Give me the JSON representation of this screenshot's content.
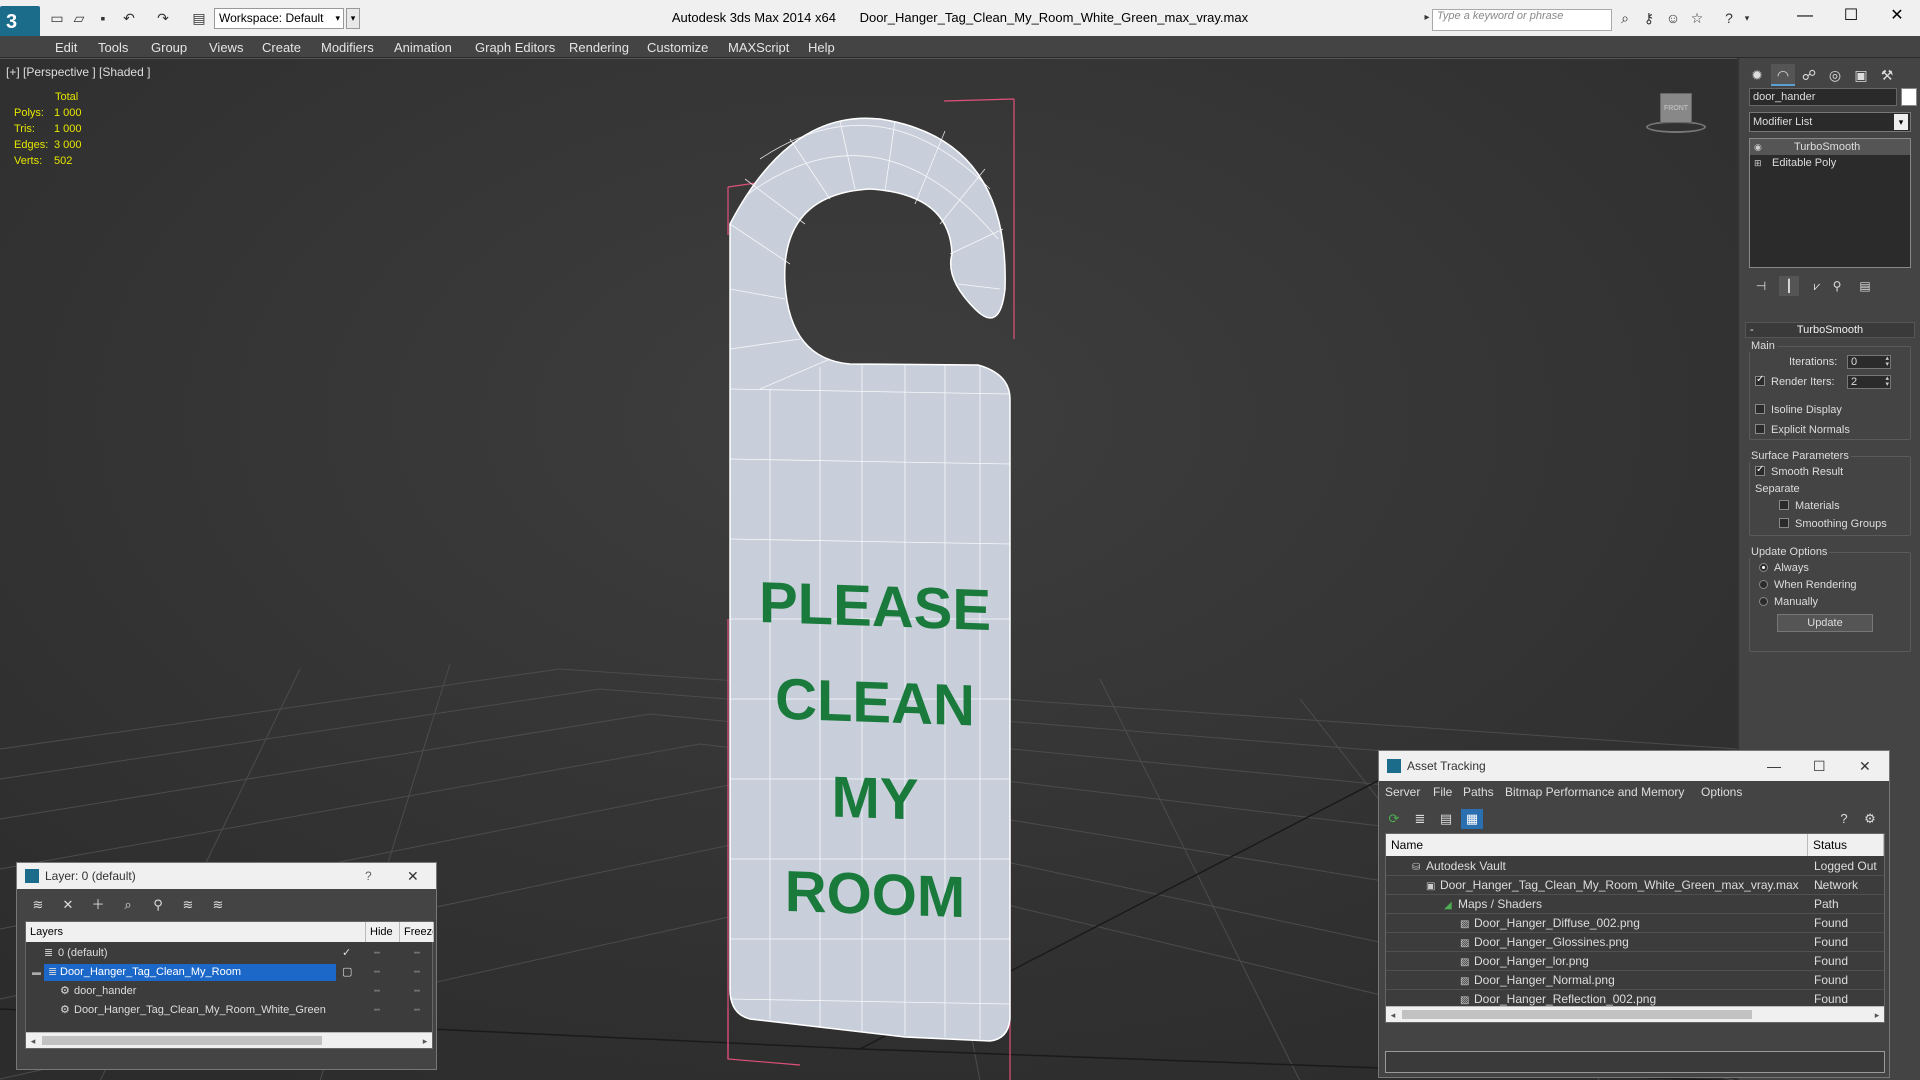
{
  "titlebar": {
    "app_title": "Autodesk 3ds Max  2014 x64",
    "file_title": "Door_Hanger_Tag_Clean_My_Room_White_Green_max_vray.max",
    "workspace": "Workspace: Default",
    "search_placeholder": "Type a keyword or phrase"
  },
  "menu": [
    "Edit",
    "Tools",
    "Group",
    "Views",
    "Create",
    "Modifiers",
    "Animation",
    "Graph Editors",
    "Rendering",
    "Customize",
    "MAXScript",
    "Help"
  ],
  "viewport": {
    "label": "[+] [Perspective ] [Shaded ]",
    "stats": {
      "header": "Total",
      "rows": [
        {
          "k": "Polys:",
          "v": "1 000"
        },
        {
          "k": "Tris:",
          "v": "1 000"
        },
        {
          "k": "Edges:",
          "v": "3 000"
        },
        {
          "k": "Verts:",
          "v": "502"
        }
      ]
    },
    "sign_text": [
      "PLEASE",
      "CLEAN",
      "MY",
      "ROOM"
    ],
    "viewcube_label": "FRONT",
    "sign_text_color": "#1a7a3c",
    "selection_color": "#e0507a"
  },
  "command_panel": {
    "object_name": "door_hander",
    "modifier_list": "Modifier List",
    "stack": [
      {
        "label": "TurboSmooth",
        "icon": "lightbulb-icon",
        "selected": true
      },
      {
        "label": "Editable Poly",
        "icon": "plus-box-icon",
        "selected": false
      }
    ],
    "rollout_title": "TurboSmooth",
    "main_group": "Main",
    "iterations_label": "Iterations:",
    "iterations_value": "0",
    "render_iters_label": "Render Iters:",
    "render_iters_value": "2",
    "render_iters_checked": true,
    "isoline_label": "Isoline Display",
    "explicit_normals_label": "Explicit Normals",
    "surface_group": "Surface Parameters",
    "smooth_result_label": "Smooth Result",
    "separate_label": "Separate",
    "materials_label": "Materials",
    "smoothing_groups_label": "Smoothing Groups",
    "update_group": "Update Options",
    "always_label": "Always",
    "when_rendering_label": "When Rendering",
    "manually_label": "Manually",
    "update_button": "Update"
  },
  "layers": {
    "title": "Layer: 0 (default)",
    "help": "?",
    "col_layers": "Layers",
    "col_hide": "Hide",
    "col_freeze": "Freeze",
    "rows": [
      {
        "name": "0 (default)",
        "indent": 0,
        "selected": false
      },
      {
        "name": "Door_Hanger_Tag_Clean_My_Room",
        "indent": 0,
        "selected": true
      },
      {
        "name": "door_hander",
        "indent": 1,
        "selected": false
      },
      {
        "name": "Door_Hanger_Tag_Clean_My_Room_White_Green",
        "indent": 1,
        "selected": false
      }
    ]
  },
  "asset": {
    "title": "Asset Tracking",
    "menu": [
      "Server",
      "File",
      "Paths",
      "Bitmap Performance and Memory",
      "Options"
    ],
    "col_name": "Name",
    "col_status": "Status",
    "rows": [
      {
        "name": "Autodesk Vault",
        "status": "Logged Out ...",
        "indent": 1
      },
      {
        "name": "Door_Hanger_Tag_Clean_My_Room_White_Green_max_vray.max",
        "status": "Network Path",
        "indent": 2
      },
      {
        "name": "Maps / Shaders",
        "status": "",
        "indent": 3
      },
      {
        "name": "Door_Hanger_Diffuse_002.png",
        "status": "Found",
        "indent": 4
      },
      {
        "name": "Door_Hanger_Glossines.png",
        "status": "Found",
        "indent": 4
      },
      {
        "name": "Door_Hanger_lor.png",
        "status": "Found",
        "indent": 4
      },
      {
        "name": "Door_Hanger_Normal.png",
        "status": "Found",
        "indent": 4
      },
      {
        "name": "Door_Hanger_Reflection_002.png",
        "status": "Found",
        "indent": 4
      }
    ]
  }
}
